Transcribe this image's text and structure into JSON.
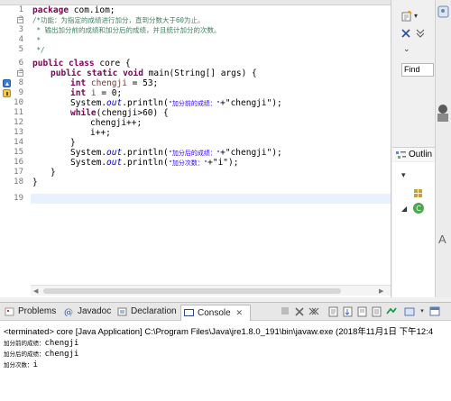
{
  "editor": {
    "line_numbers": [
      "1",
      "2",
      "3",
      "4",
      "5",
      "6",
      "7",
      "8",
      "9",
      "10",
      "11",
      "12",
      "13",
      "14",
      "15",
      "16",
      "17",
      "18",
      "19"
    ],
    "code": {
      "l1_kw": "package",
      "l1_rest": " com.iom;",
      "l2": "/*功能：为指定的成绩进行加分，直到分数大于60为止。",
      "l3": " * 输出加分前的成绩和加分后的成绩，并且统计加分的次数。",
      "l4": " *",
      "l5": " */",
      "l6_kw": "public class",
      "l6_rest": " core {",
      "l7_kw": "public static void",
      "l7_rest": " main(String[] args) {",
      "l8_kw": "int",
      "l8_var": "chengji",
      "l8_rest": " = 53;",
      "l9_kw": "int",
      "l9_var": "i",
      "l9_rest": " = 0;",
      "l10_pre": "System.",
      "l10_out": "out",
      "l10_mid": ".println(",
      "l10_str": "\"加分前的成绩：\"",
      "l10_post": "+\"chengji\");",
      "l11_kw": "while",
      "l11_rest": "(chengji>60) {",
      "l12": "chengji++;",
      "l13": "i++;",
      "l14": "}",
      "l15_pre": "System.",
      "l15_out": "out",
      "l15_mid": ".println(",
      "l15_str": "\"加分后的成绩：\"",
      "l15_post": "+\"chengji\");",
      "l16_pre": "System.",
      "l16_out": "out",
      "l16_mid": ".println(",
      "l16_str": "\"加分次数：\"",
      "l16_post": "+\"i\");",
      "l17": "}",
      "l18": "}"
    }
  },
  "right_panel": {
    "find_label": "Find",
    "outline_title": "Outlin",
    "letter": "A"
  },
  "console": {
    "tabs": [
      {
        "label": "Problems"
      },
      {
        "label": "Javadoc"
      },
      {
        "label": "Declaration"
      },
      {
        "label": "Console"
      }
    ],
    "close_glyph": "✕",
    "status": "<terminated> core [Java Application] C:\\Program Files\\Java\\jre1.8.0_191\\bin\\javaw.exe (2018年11月1日 下午12:4",
    "output": [
      {
        "prefix": "加分前的成绩：",
        "value": "chengji"
      },
      {
        "prefix": "加分后的成绩：",
        "value": "chengji"
      },
      {
        "prefix": "加分次数：",
        "value": "i"
      }
    ]
  },
  "colors": {
    "keyword": "#7f0055",
    "comment": "#3f7f5f",
    "string": "#2a00ff",
    "static_field": "#0000c0",
    "local_var": "#6a3e3e",
    "line_highlight": "#e8f2fe"
  }
}
